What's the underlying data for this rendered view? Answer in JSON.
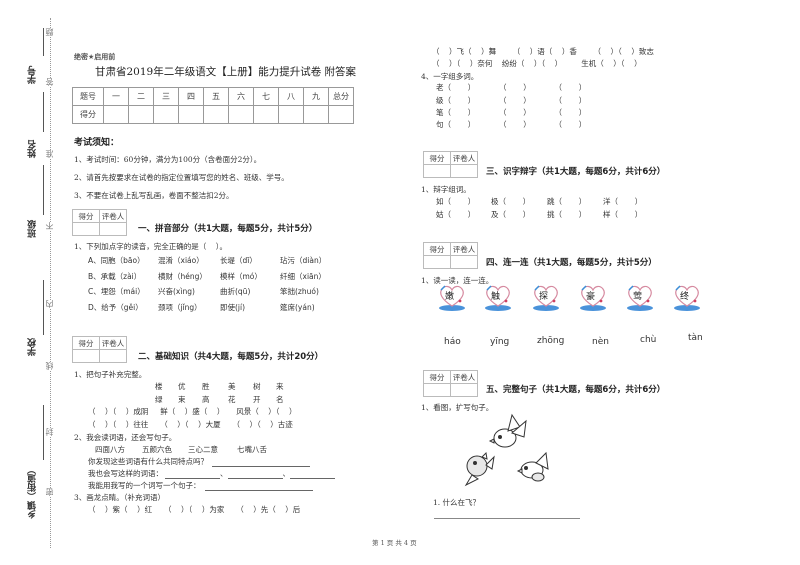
{
  "binding_margin": {
    "labels": [
      "学号",
      "姓名",
      "班级",
      "学校",
      "乡镇（街道）"
    ],
    "seal_chars": [
      "题",
      "答",
      "准",
      "不",
      "内",
      "线",
      "封",
      "密"
    ]
  },
  "header": {
    "secret_tag": "绝密★启用前",
    "title": "甘肃省2019年二年级语文【上册】能力提升试卷 附答案"
  },
  "score_table": {
    "headers": [
      "题号",
      "一",
      "二",
      "三",
      "四",
      "五",
      "六",
      "七",
      "八",
      "九",
      "总分"
    ],
    "row_label": "得分"
  },
  "notice": {
    "heading": "考试须知：",
    "items": [
      "1、考试时间：60分钟，满分为100分（含卷面分2分）。",
      "2、请首先按要求在试卷的指定位置填写您的姓名、班级、学号。",
      "3、不要在试卷上乱写乱画，卷面不整洁扣2分。"
    ]
  },
  "grader_box": {
    "score_label": "得分",
    "grader_label": "评卷人"
  },
  "section1": {
    "title": "一、拼音部分（共1大题，每题5分，共计5分）",
    "question": "1、下列加点字的读音，完全正确的是（    ）。",
    "options": [
      [
        "A、同胞（bāo）",
        "混淆（xiáo）",
        "长堤（dī）",
        "玷污（diàn）"
      ],
      [
        "B、承载（zài）",
        "横财（héng）",
        "模样（mó）",
        "纤细（xiān）"
      ],
      [
        "C、埋怨（mái）",
        "兴奋(xìng)",
        "曲折(qū)",
        "笨拙(zhuó)"
      ],
      [
        "D、给予（gěi）",
        "颈项（jǐng）",
        "即使(jí)",
        "筵席(yán)"
      ]
    ]
  },
  "section2": {
    "title": "二、基础知识（共4大题，每题5分，共计20分）",
    "q1": "1、把句子补充完整。",
    "q1_chars_row1": [
      "楼",
      "优",
      "胜",
      "美",
      "树",
      "来"
    ],
    "q1_chars_row2": [
      "绿",
      "束",
      "高",
      "花",
      "开",
      "名"
    ],
    "q1_line1": "（    ）（    ）成阴     鲜（    ）盛（    ）     风景（    ）（    ）",
    "q1_line2": "（    ）（    ）往往     （    ）（    ）大厦     （    ）（    ）古迹",
    "q2": "2、我会读词语，还会写句子。",
    "q2_words": [
      "四面八方",
      "五颜六色",
      "三心二意",
      "七嘴八舌"
    ],
    "q2_prompts": [
      "你发现这些词语有什么共同特点吗？",
      "我也会写这样的词语：",
      "我能用我写的一个词写一个句子："
    ],
    "q3": "3、画龙点睛。（补充词语）",
    "q3_line1": "（    ）紫（    ）红     （    ）（    ）为家     （    ）先（    ）后"
  },
  "right_top": {
    "line1": "（    ）飞（    ）舞       （    ）语（    ）香       （    ）（    ）致志",
    "line2": "（    ）（    ）奈何    纷纷（    ）（    ）        生机（    ）（    ）",
    "q4": "4、一字组多词。",
    "q4_chars": [
      "老",
      "级",
      "笔",
      "句"
    ]
  },
  "section3": {
    "title": "三、识字辩字（共1大题，每题6分，共计6分）",
    "q1": "1、辩字组词。",
    "row1": [
      "如",
      "极",
      "跳",
      "洋"
    ],
    "row2": [
      "姑",
      "及",
      "挑",
      "样"
    ]
  },
  "section4": {
    "title": "四、连一连（共1大题，每题5分，共计5分）",
    "q1": "1、读一读，连一连。",
    "hearts": [
      "嫩",
      "触",
      "探",
      "豪",
      "莺",
      "终"
    ],
    "pinyin": [
      "háo",
      "yīng",
      "zhōng",
      "nèn",
      "chù",
      "tàn"
    ]
  },
  "section5": {
    "title": "五、完整句子（共1大题，每题6分，共计6分）",
    "q1": "1、看图，扩写句子。",
    "sub1": "1. 什么在飞？"
  },
  "footer": {
    "page": "第 1 页 共 4 页"
  }
}
